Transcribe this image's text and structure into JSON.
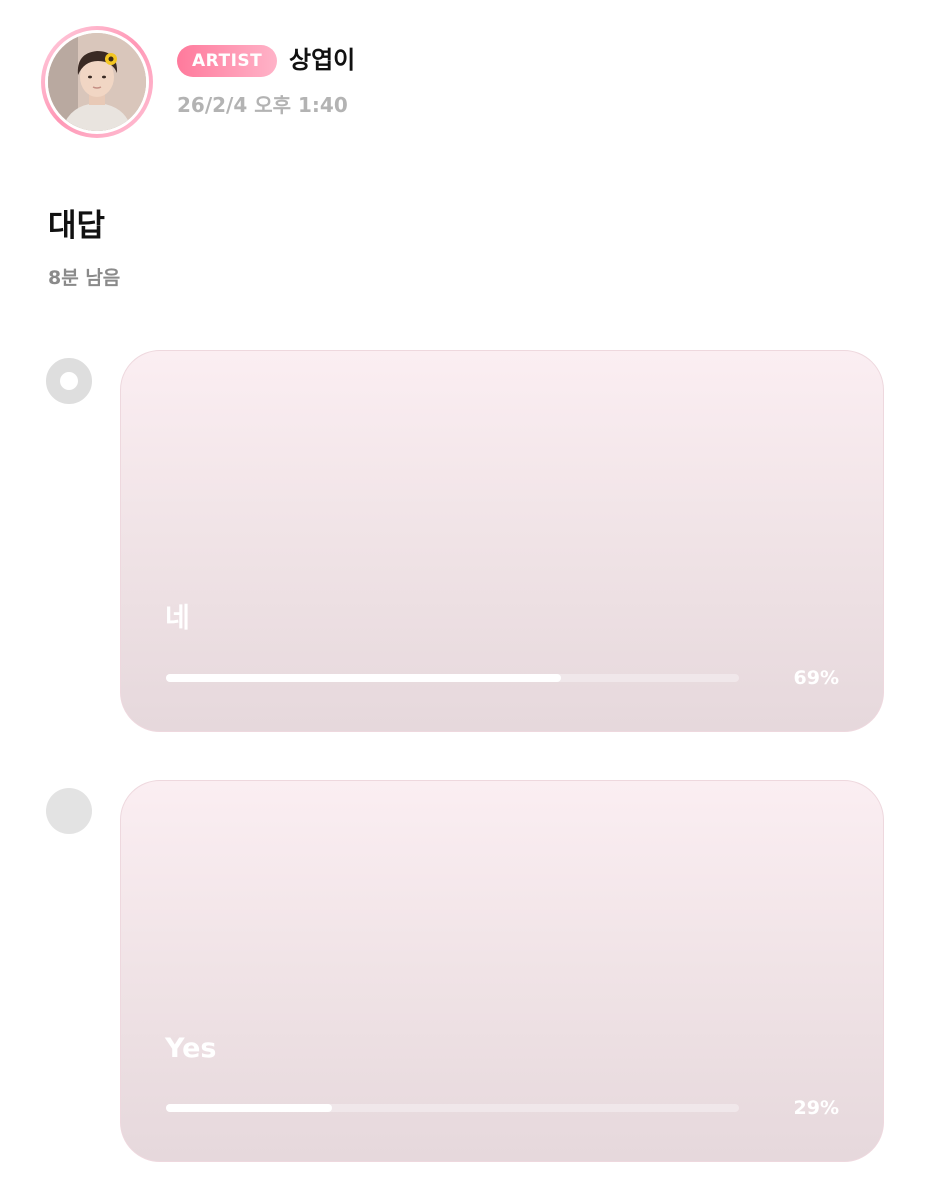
{
  "post": {
    "badge": "ARTIST",
    "author": "상엽이",
    "timestamp": "26/2/4 오후 1:40",
    "avatar_icon": "profile-photo"
  },
  "poll": {
    "title": "대답",
    "remaining": "8분 남음",
    "options": [
      {
        "label": "네",
        "percent_text": "69%",
        "percent": 69,
        "selected": true
      },
      {
        "label": "Yes",
        "percent_text": "29%",
        "percent": 29,
        "selected": false
      }
    ]
  },
  "colors": {
    "badge_start": "#ff7a9c",
    "badge_end": "#ffb3c8",
    "card_top": "#fbeef2",
    "card_bottom": "#e6d8dc",
    "bar_fill": "#ffffff"
  }
}
